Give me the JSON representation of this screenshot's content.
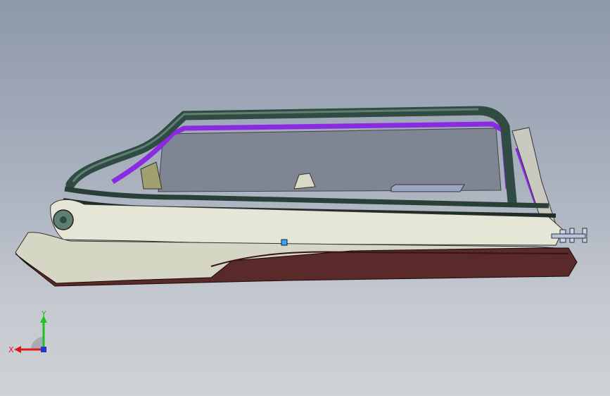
{
  "triad": {
    "x_label": "X",
    "y_label": "Y",
    "x_color": "#e01818",
    "y_color": "#20c020",
    "z_color": "#1a3ad0"
  },
  "colors": {
    "background_top": "#8d98ab",
    "background_bottom": "#cfd2d6",
    "frame_tube": "#2f4b42",
    "seal_strip": "#8a2be2",
    "glass": "#7f8593",
    "trim_panel": "#e6e6d6",
    "lower_shell": "#5a2a2a"
  }
}
